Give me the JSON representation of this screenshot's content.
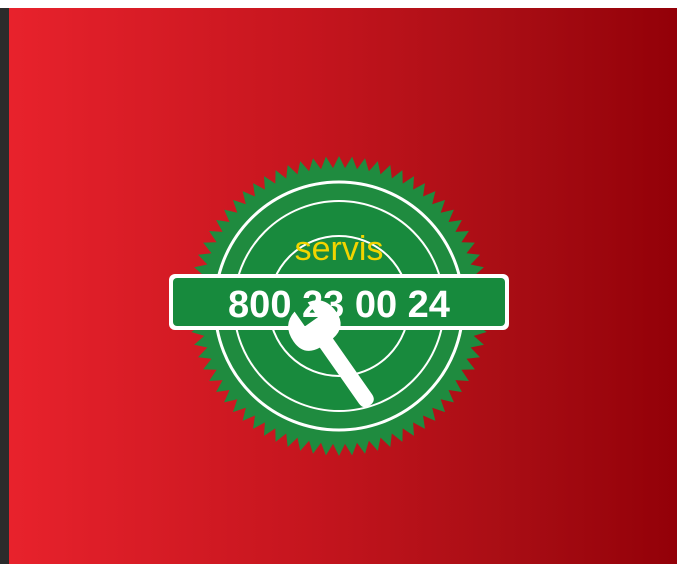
{
  "badge": {
    "label": "servis",
    "phone": "800 23 00 24",
    "icon": "wrench-icon"
  },
  "colors": {
    "background_light": "#e8222c",
    "background_dark": "#930008",
    "seal_green": "#1f8b3f",
    "seal_green_dark": "#137a33",
    "label_yellow": "#f2d400",
    "white": "#ffffff"
  }
}
